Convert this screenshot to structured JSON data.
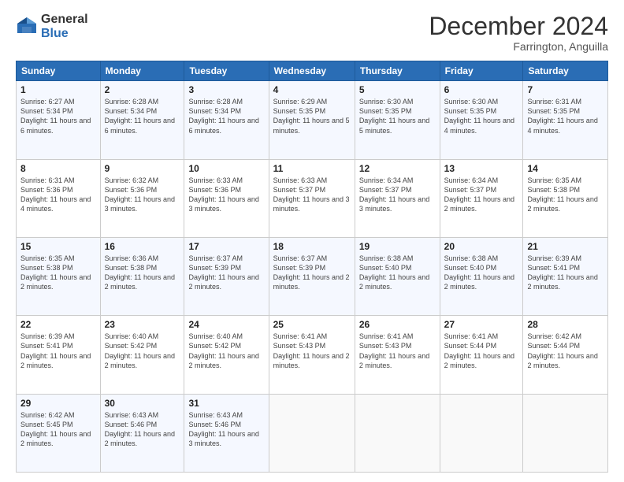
{
  "logo": {
    "general": "General",
    "blue": "Blue"
  },
  "title": "December 2024",
  "subtitle": "Farrington, Anguilla",
  "days_header": [
    "Sunday",
    "Monday",
    "Tuesday",
    "Wednesday",
    "Thursday",
    "Friday",
    "Saturday"
  ],
  "weeks": [
    [
      {
        "day": "1",
        "sunrise": "Sunrise: 6:27 AM",
        "sunset": "Sunset: 5:34 PM",
        "daylight": "Daylight: 11 hours and 6 minutes."
      },
      {
        "day": "2",
        "sunrise": "Sunrise: 6:28 AM",
        "sunset": "Sunset: 5:34 PM",
        "daylight": "Daylight: 11 hours and 6 minutes."
      },
      {
        "day": "3",
        "sunrise": "Sunrise: 6:28 AM",
        "sunset": "Sunset: 5:34 PM",
        "daylight": "Daylight: 11 hours and 6 minutes."
      },
      {
        "day": "4",
        "sunrise": "Sunrise: 6:29 AM",
        "sunset": "Sunset: 5:35 PM",
        "daylight": "Daylight: 11 hours and 5 minutes."
      },
      {
        "day": "5",
        "sunrise": "Sunrise: 6:30 AM",
        "sunset": "Sunset: 5:35 PM",
        "daylight": "Daylight: 11 hours and 5 minutes."
      },
      {
        "day": "6",
        "sunrise": "Sunrise: 6:30 AM",
        "sunset": "Sunset: 5:35 PM",
        "daylight": "Daylight: 11 hours and 4 minutes."
      },
      {
        "day": "7",
        "sunrise": "Sunrise: 6:31 AM",
        "sunset": "Sunset: 5:35 PM",
        "daylight": "Daylight: 11 hours and 4 minutes."
      }
    ],
    [
      {
        "day": "8",
        "sunrise": "Sunrise: 6:31 AM",
        "sunset": "Sunset: 5:36 PM",
        "daylight": "Daylight: 11 hours and 4 minutes."
      },
      {
        "day": "9",
        "sunrise": "Sunrise: 6:32 AM",
        "sunset": "Sunset: 5:36 PM",
        "daylight": "Daylight: 11 hours and 3 minutes."
      },
      {
        "day": "10",
        "sunrise": "Sunrise: 6:33 AM",
        "sunset": "Sunset: 5:36 PM",
        "daylight": "Daylight: 11 hours and 3 minutes."
      },
      {
        "day": "11",
        "sunrise": "Sunrise: 6:33 AM",
        "sunset": "Sunset: 5:37 PM",
        "daylight": "Daylight: 11 hours and 3 minutes."
      },
      {
        "day": "12",
        "sunrise": "Sunrise: 6:34 AM",
        "sunset": "Sunset: 5:37 PM",
        "daylight": "Daylight: 11 hours and 3 minutes."
      },
      {
        "day": "13",
        "sunrise": "Sunrise: 6:34 AM",
        "sunset": "Sunset: 5:37 PM",
        "daylight": "Daylight: 11 hours and 2 minutes."
      },
      {
        "day": "14",
        "sunrise": "Sunrise: 6:35 AM",
        "sunset": "Sunset: 5:38 PM",
        "daylight": "Daylight: 11 hours and 2 minutes."
      }
    ],
    [
      {
        "day": "15",
        "sunrise": "Sunrise: 6:35 AM",
        "sunset": "Sunset: 5:38 PM",
        "daylight": "Daylight: 11 hours and 2 minutes."
      },
      {
        "day": "16",
        "sunrise": "Sunrise: 6:36 AM",
        "sunset": "Sunset: 5:38 PM",
        "daylight": "Daylight: 11 hours and 2 minutes."
      },
      {
        "day": "17",
        "sunrise": "Sunrise: 6:37 AM",
        "sunset": "Sunset: 5:39 PM",
        "daylight": "Daylight: 11 hours and 2 minutes."
      },
      {
        "day": "18",
        "sunrise": "Sunrise: 6:37 AM",
        "sunset": "Sunset: 5:39 PM",
        "daylight": "Daylight: 11 hours and 2 minutes."
      },
      {
        "day": "19",
        "sunrise": "Sunrise: 6:38 AM",
        "sunset": "Sunset: 5:40 PM",
        "daylight": "Daylight: 11 hours and 2 minutes."
      },
      {
        "day": "20",
        "sunrise": "Sunrise: 6:38 AM",
        "sunset": "Sunset: 5:40 PM",
        "daylight": "Daylight: 11 hours and 2 minutes."
      },
      {
        "day": "21",
        "sunrise": "Sunrise: 6:39 AM",
        "sunset": "Sunset: 5:41 PM",
        "daylight": "Daylight: 11 hours and 2 minutes."
      }
    ],
    [
      {
        "day": "22",
        "sunrise": "Sunrise: 6:39 AM",
        "sunset": "Sunset: 5:41 PM",
        "daylight": "Daylight: 11 hours and 2 minutes."
      },
      {
        "day": "23",
        "sunrise": "Sunrise: 6:40 AM",
        "sunset": "Sunset: 5:42 PM",
        "daylight": "Daylight: 11 hours and 2 minutes."
      },
      {
        "day": "24",
        "sunrise": "Sunrise: 6:40 AM",
        "sunset": "Sunset: 5:42 PM",
        "daylight": "Daylight: 11 hours and 2 minutes."
      },
      {
        "day": "25",
        "sunrise": "Sunrise: 6:41 AM",
        "sunset": "Sunset: 5:43 PM",
        "daylight": "Daylight: 11 hours and 2 minutes."
      },
      {
        "day": "26",
        "sunrise": "Sunrise: 6:41 AM",
        "sunset": "Sunset: 5:43 PM",
        "daylight": "Daylight: 11 hours and 2 minutes."
      },
      {
        "day": "27",
        "sunrise": "Sunrise: 6:41 AM",
        "sunset": "Sunset: 5:44 PM",
        "daylight": "Daylight: 11 hours and 2 minutes."
      },
      {
        "day": "28",
        "sunrise": "Sunrise: 6:42 AM",
        "sunset": "Sunset: 5:44 PM",
        "daylight": "Daylight: 11 hours and 2 minutes."
      }
    ],
    [
      {
        "day": "29",
        "sunrise": "Sunrise: 6:42 AM",
        "sunset": "Sunset: 5:45 PM",
        "daylight": "Daylight: 11 hours and 2 minutes."
      },
      {
        "day": "30",
        "sunrise": "Sunrise: 6:43 AM",
        "sunset": "Sunset: 5:46 PM",
        "daylight": "Daylight: 11 hours and 2 minutes."
      },
      {
        "day": "31",
        "sunrise": "Sunrise: 6:43 AM",
        "sunset": "Sunset: 5:46 PM",
        "daylight": "Daylight: 11 hours and 3 minutes."
      },
      {
        "day": "",
        "sunrise": "",
        "sunset": "",
        "daylight": ""
      },
      {
        "day": "",
        "sunrise": "",
        "sunset": "",
        "daylight": ""
      },
      {
        "day": "",
        "sunrise": "",
        "sunset": "",
        "daylight": ""
      },
      {
        "day": "",
        "sunrise": "",
        "sunset": "",
        "daylight": ""
      }
    ]
  ]
}
